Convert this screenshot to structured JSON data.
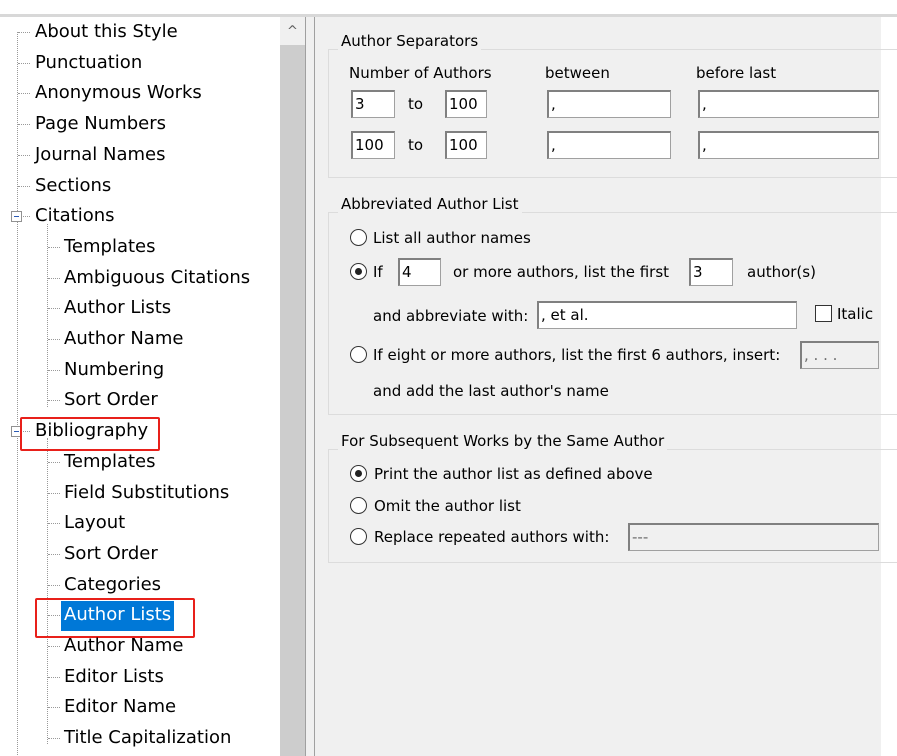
{
  "tree": {
    "items": [
      {
        "label": "About this Style",
        "level": 1
      },
      {
        "label": "Punctuation",
        "level": 1
      },
      {
        "label": "Anonymous Works",
        "level": 1
      },
      {
        "label": "Page Numbers",
        "level": 1
      },
      {
        "label": "Journal Names",
        "level": 1
      },
      {
        "label": "Sections",
        "level": 1
      },
      {
        "label": "Citations",
        "level": 1,
        "expanded": true
      },
      {
        "label": "Templates",
        "level": 2
      },
      {
        "label": "Ambiguous Citations",
        "level": 2
      },
      {
        "label": "Author Lists",
        "level": 2
      },
      {
        "label": "Author Name",
        "level": 2
      },
      {
        "label": "Numbering",
        "level": 2
      },
      {
        "label": "Sort Order",
        "level": 2
      },
      {
        "label": "Bibliography",
        "level": 1,
        "expanded": true,
        "highlighted": true
      },
      {
        "label": "Templates",
        "level": 2
      },
      {
        "label": "Field Substitutions",
        "level": 2
      },
      {
        "label": "Layout",
        "level": 2
      },
      {
        "label": "Sort Order",
        "level": 2
      },
      {
        "label": "Categories",
        "level": 2
      },
      {
        "label": "Author Lists",
        "level": 2,
        "selected": true,
        "highlighted": true
      },
      {
        "label": "Author Name",
        "level": 2
      },
      {
        "label": "Editor Lists",
        "level": 2
      },
      {
        "label": "Editor Name",
        "level": 2
      },
      {
        "label": "Title Capitalization",
        "level": 2
      }
    ],
    "selection_color": "#0078d7",
    "annotation_color": "#e8201a"
  },
  "scrollbar": {
    "up_icon": "^"
  },
  "separators": {
    "title": "Author Separators",
    "col_number": "Number of Authors",
    "col_between": "between",
    "col_before_last": "before last",
    "to_label": "to",
    "rows": [
      {
        "from": "3",
        "to": "100",
        "between": ",",
        "before_last": ","
      },
      {
        "from": "100",
        "to": "100",
        "between": ",",
        "before_last": ","
      }
    ]
  },
  "abbreviated": {
    "title": "Abbreviated Author List",
    "list_all": "List all author names",
    "if_label": "If",
    "if_count": "4",
    "more_authors": "or more authors, list the first",
    "first_count": "3",
    "authors_suffix": "author(s)",
    "abbreviate_label": "and abbreviate with:",
    "abbreviate_value": ", et al.",
    "italic_label": "Italic",
    "eight_label": "If eight or more authors, list the first 6 authors, insert:",
    "eight_value": ", . . .",
    "add_last": "and add the last author's name",
    "selected": "if"
  },
  "subsequent": {
    "title": "For Subsequent Works by the Same Author",
    "print": "Print the author list as defined above",
    "omit": "Omit the author list",
    "replace": "Replace repeated authors with:",
    "replace_value": "---",
    "selected": "print"
  }
}
